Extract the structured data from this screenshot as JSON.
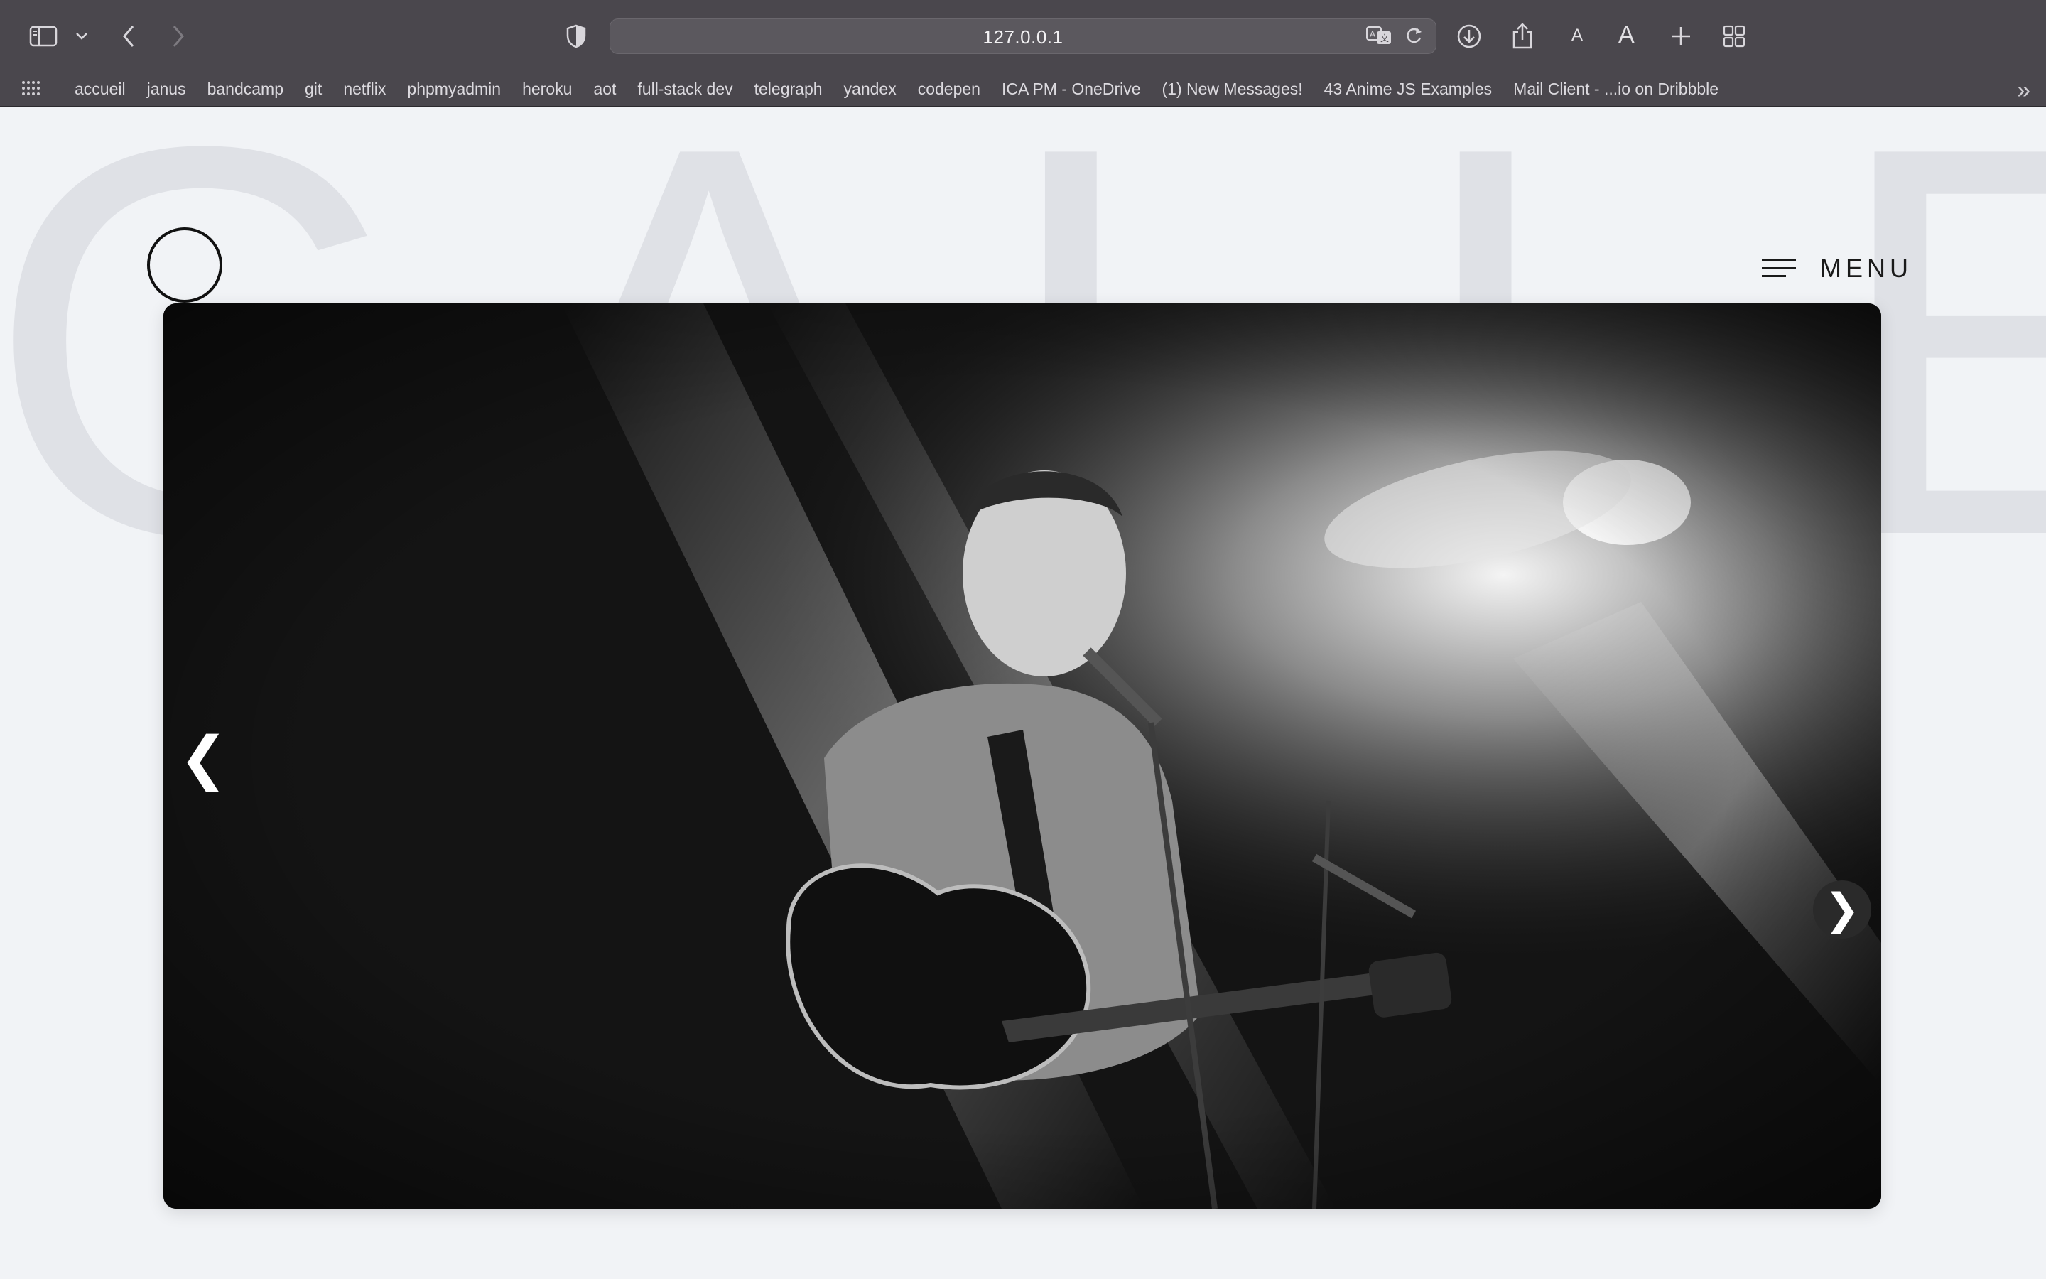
{
  "browser": {
    "url": "127.0.0.1",
    "toolbar_icons": [
      "sidebar-icon",
      "chevron-down-icon",
      "back-icon",
      "forward-icon",
      "shield-icon",
      "translate-icon",
      "reload-icon",
      "download-icon",
      "share-icon",
      "new-tab-icon",
      "tab-overview-icon"
    ],
    "text_small": "A",
    "text_large": "A",
    "bookmarks": [
      "accueil",
      "janus",
      "bandcamp",
      "git",
      "netflix",
      "phpmyadmin",
      "heroku",
      "aot",
      "full-stack dev",
      "telegraph",
      "yandex",
      "codepen",
      "ICA PM - OneDrive",
      "(1) New Messages!",
      "43 Anime JS Examples",
      "Mail Client - ...io on Dribbble"
    ],
    "more_bookmarks": "»"
  },
  "page": {
    "background_title": "GALLERY",
    "menu_label": "MENU",
    "slider": {
      "prev_arrow": "❮",
      "next_arrow": "❯"
    }
  },
  "colors": {
    "chrome": "#4a474d",
    "page_bg": "#f1f3f6",
    "bg_title": "#dfe1e6",
    "text_dark": "#1a1a1a"
  }
}
